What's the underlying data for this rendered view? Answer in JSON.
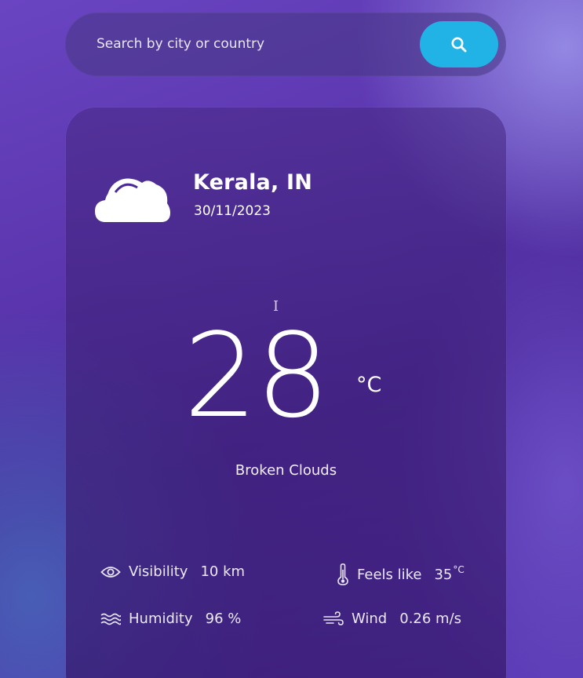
{
  "search": {
    "placeholder": "Search by city or country",
    "button_icon": "search-icon",
    "button_color": "#22b3e6"
  },
  "weather": {
    "icon": "broken-clouds-icon",
    "location": "Kerala, IN",
    "date": "30/11/2023",
    "temperature": "28",
    "temperature_unit": "°C",
    "condition": "Broken Clouds"
  },
  "stats": {
    "visibility": {
      "icon": "eye-icon",
      "label": "Visibility",
      "value": "10 km"
    },
    "humidity": {
      "icon": "waves-icon",
      "label": "Humidity",
      "value": "96 %"
    },
    "feels_like": {
      "icon": "thermometer-icon",
      "label": "Feels like",
      "value": "35",
      "unit": "°C"
    },
    "wind": {
      "icon": "wind-icon",
      "label": "Wind",
      "value": "0.26 m/s"
    }
  },
  "text_cursor": "I"
}
